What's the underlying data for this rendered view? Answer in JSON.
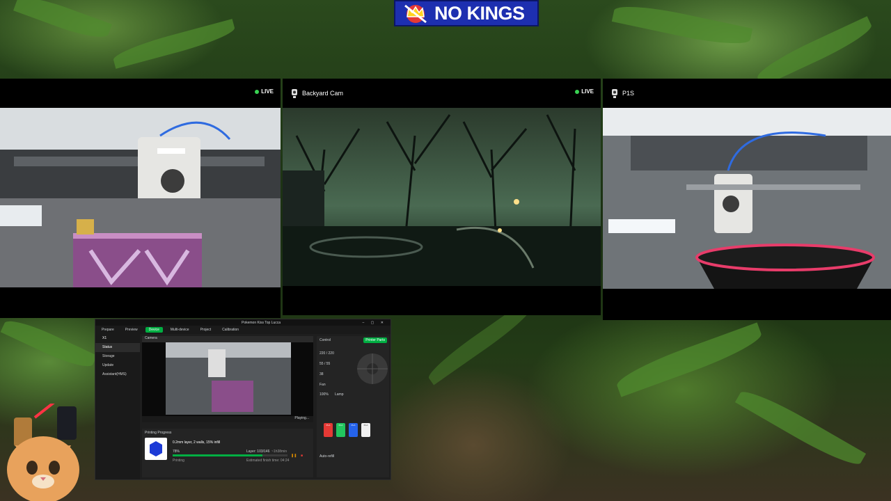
{
  "banner": {
    "text": "NO KINGS"
  },
  "cams": [
    {
      "title": "",
      "live": "LIVE"
    },
    {
      "title": "Backyard Cam",
      "live": "LIVE"
    },
    {
      "title": "P1S",
      "live": ""
    }
  ],
  "studio": {
    "window_title": "Pokemon Kiss Top Lucca",
    "tabs": [
      "Prepare",
      "Preview",
      "Device",
      "Multi-device",
      "Project",
      "Calibration"
    ],
    "active_tab": "Device",
    "printer_name": "X1",
    "sidebar": [
      "Status",
      "Storage",
      "Update",
      "Assistant(HMS)"
    ],
    "camera_label": "Camera",
    "camera_status": "Playing...",
    "control_label": "Control",
    "printer_parts_button": "Printer Parts",
    "temps": [
      "220 / 220",
      "55 / 55",
      "38"
    ],
    "fan_label": "Fan",
    "fan_value": "100%",
    "lamp_label": "Lamp",
    "progress_header": "Printing Progress",
    "job_name": "0.2mm layer, 2 walls, 15% infill",
    "progress_pct": "78%",
    "progress_value": 0.78,
    "layer": "Layer: 103/146",
    "remaining": "~1h38min",
    "status": "Printing",
    "finish_time": "Estimated finish time: 04:24",
    "ams_label": "Auto-refill",
    "spools": [
      {
        "label": "PLA",
        "color": "#e53935"
      },
      {
        "label": "PLA",
        "color": "#22c55e"
      },
      {
        "label": "PLA",
        "color": "#2563eb"
      },
      {
        "label": "PLA",
        "color": "#f1f1f1"
      }
    ]
  }
}
